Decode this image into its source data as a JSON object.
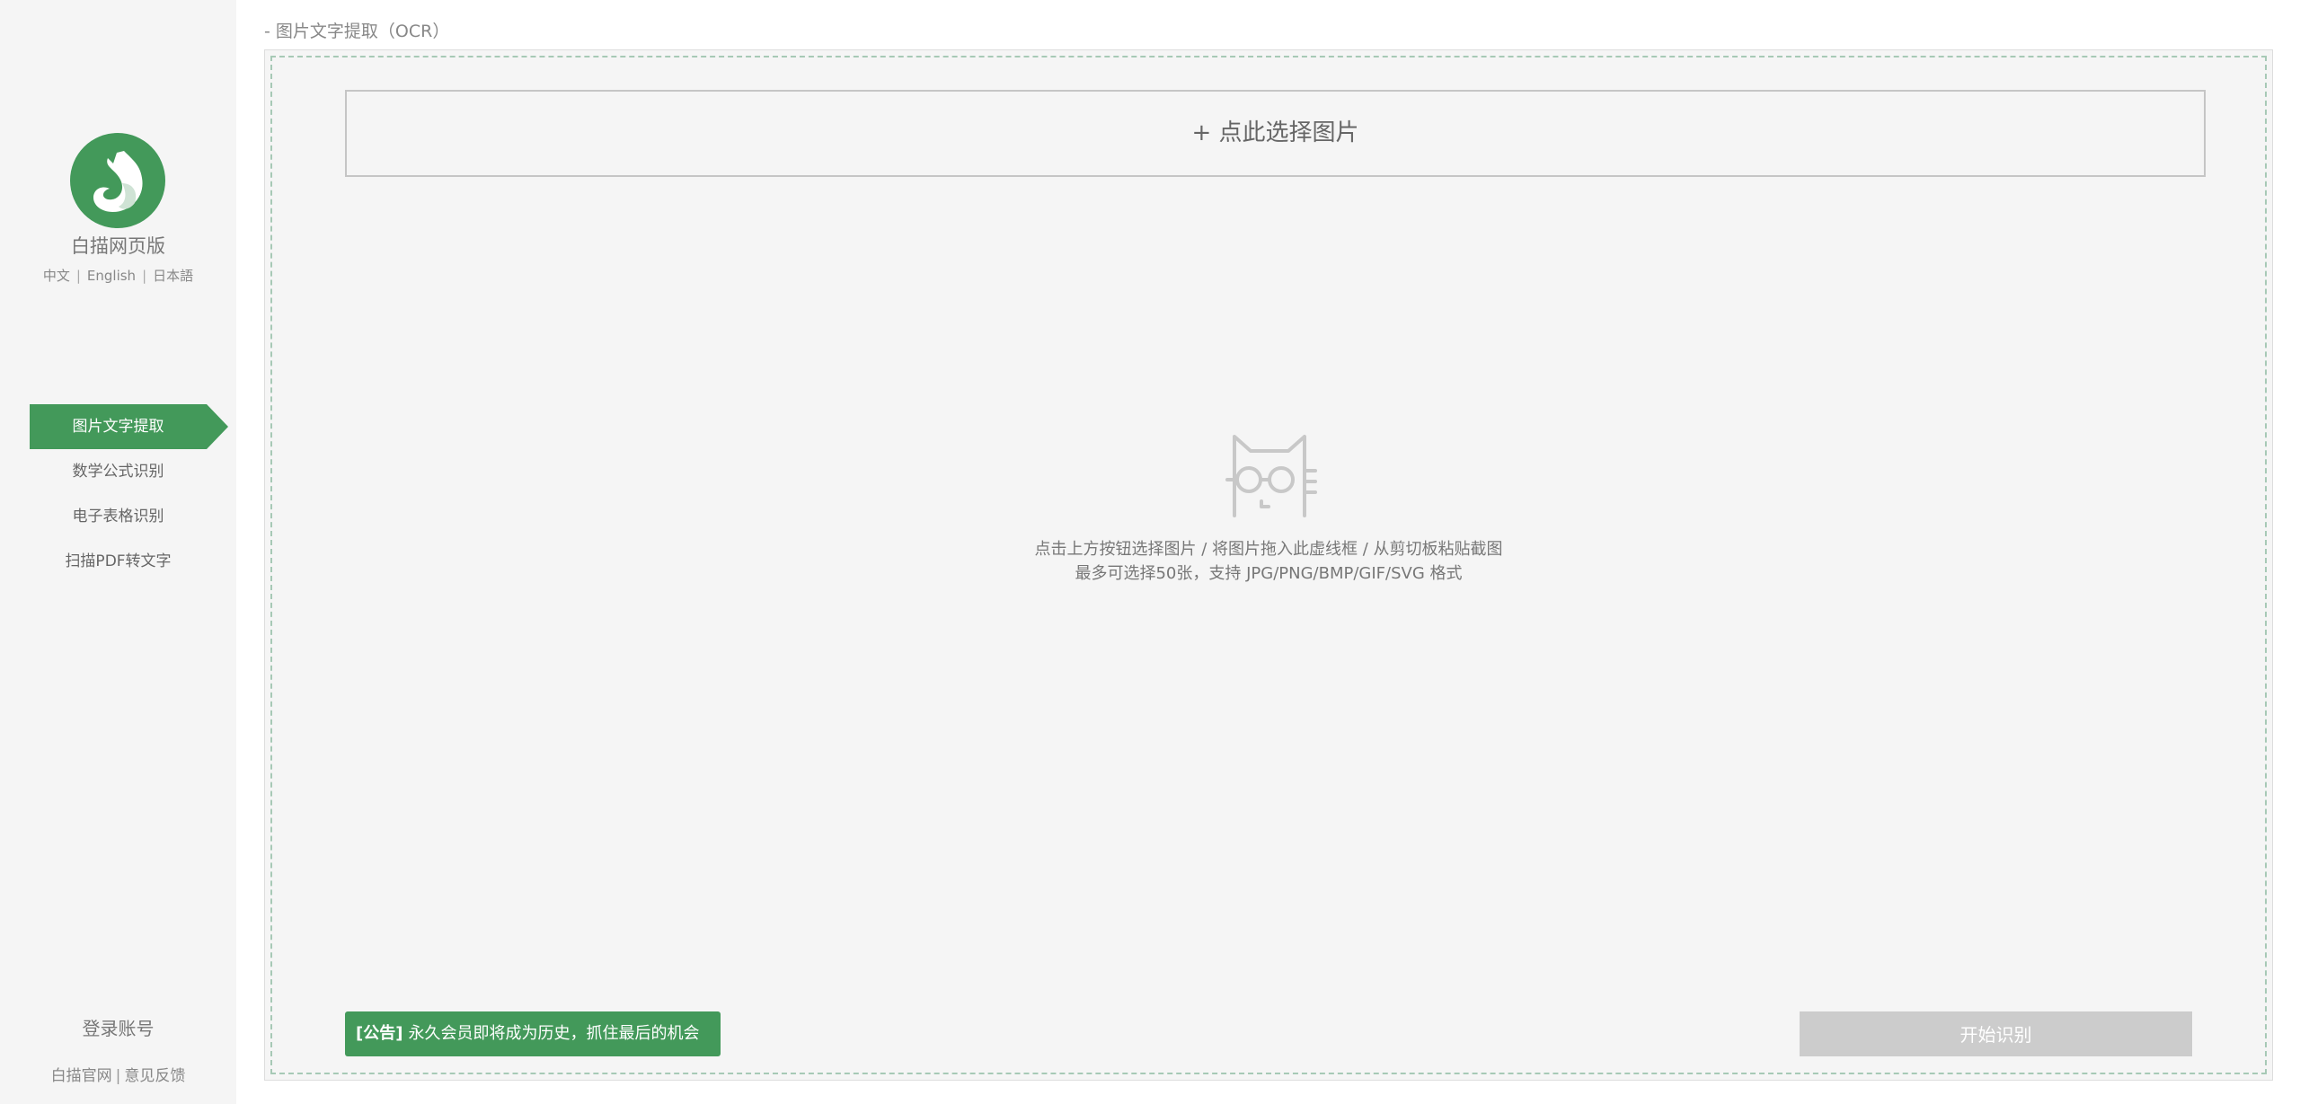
{
  "app": {
    "name": "白描网页版"
  },
  "languages": [
    "中文",
    "English",
    "日本語"
  ],
  "nav": {
    "items": [
      {
        "label": "图片文字提取",
        "active": true
      },
      {
        "label": "数学公式识别",
        "active": false
      },
      {
        "label": "电子表格识别",
        "active": false
      },
      {
        "label": "扫描PDF转文字",
        "active": false
      }
    ]
  },
  "account": {
    "login_label": "登录账号",
    "official_site": "白描官网",
    "feedback": "意见反馈",
    "separator": "|"
  },
  "page": {
    "title": "- 图片文字提取（OCR）"
  },
  "upload": {
    "select_label": "+ 点此选择图片",
    "hint_line1": "点击上方按钮选择图片 / 将图片拖入此虚线框 / 从剪切板粘贴截图",
    "hint_line2": "最多可选择50张，支持 JPG/PNG/BMP/GIF/SVG 格式"
  },
  "notice": {
    "tag": "[公告]",
    "text": "永久会员即将成为历史，抓住最后的机会"
  },
  "actions": {
    "start_label": "开始识别"
  },
  "colors": {
    "brand_green": "#43995a",
    "disabled_gray": "#cccccc",
    "sidebar_bg": "#f5f5f5"
  },
  "icons": {
    "logo": "cat-swirl-logo",
    "placeholder": "cat-with-glasses-icon"
  }
}
